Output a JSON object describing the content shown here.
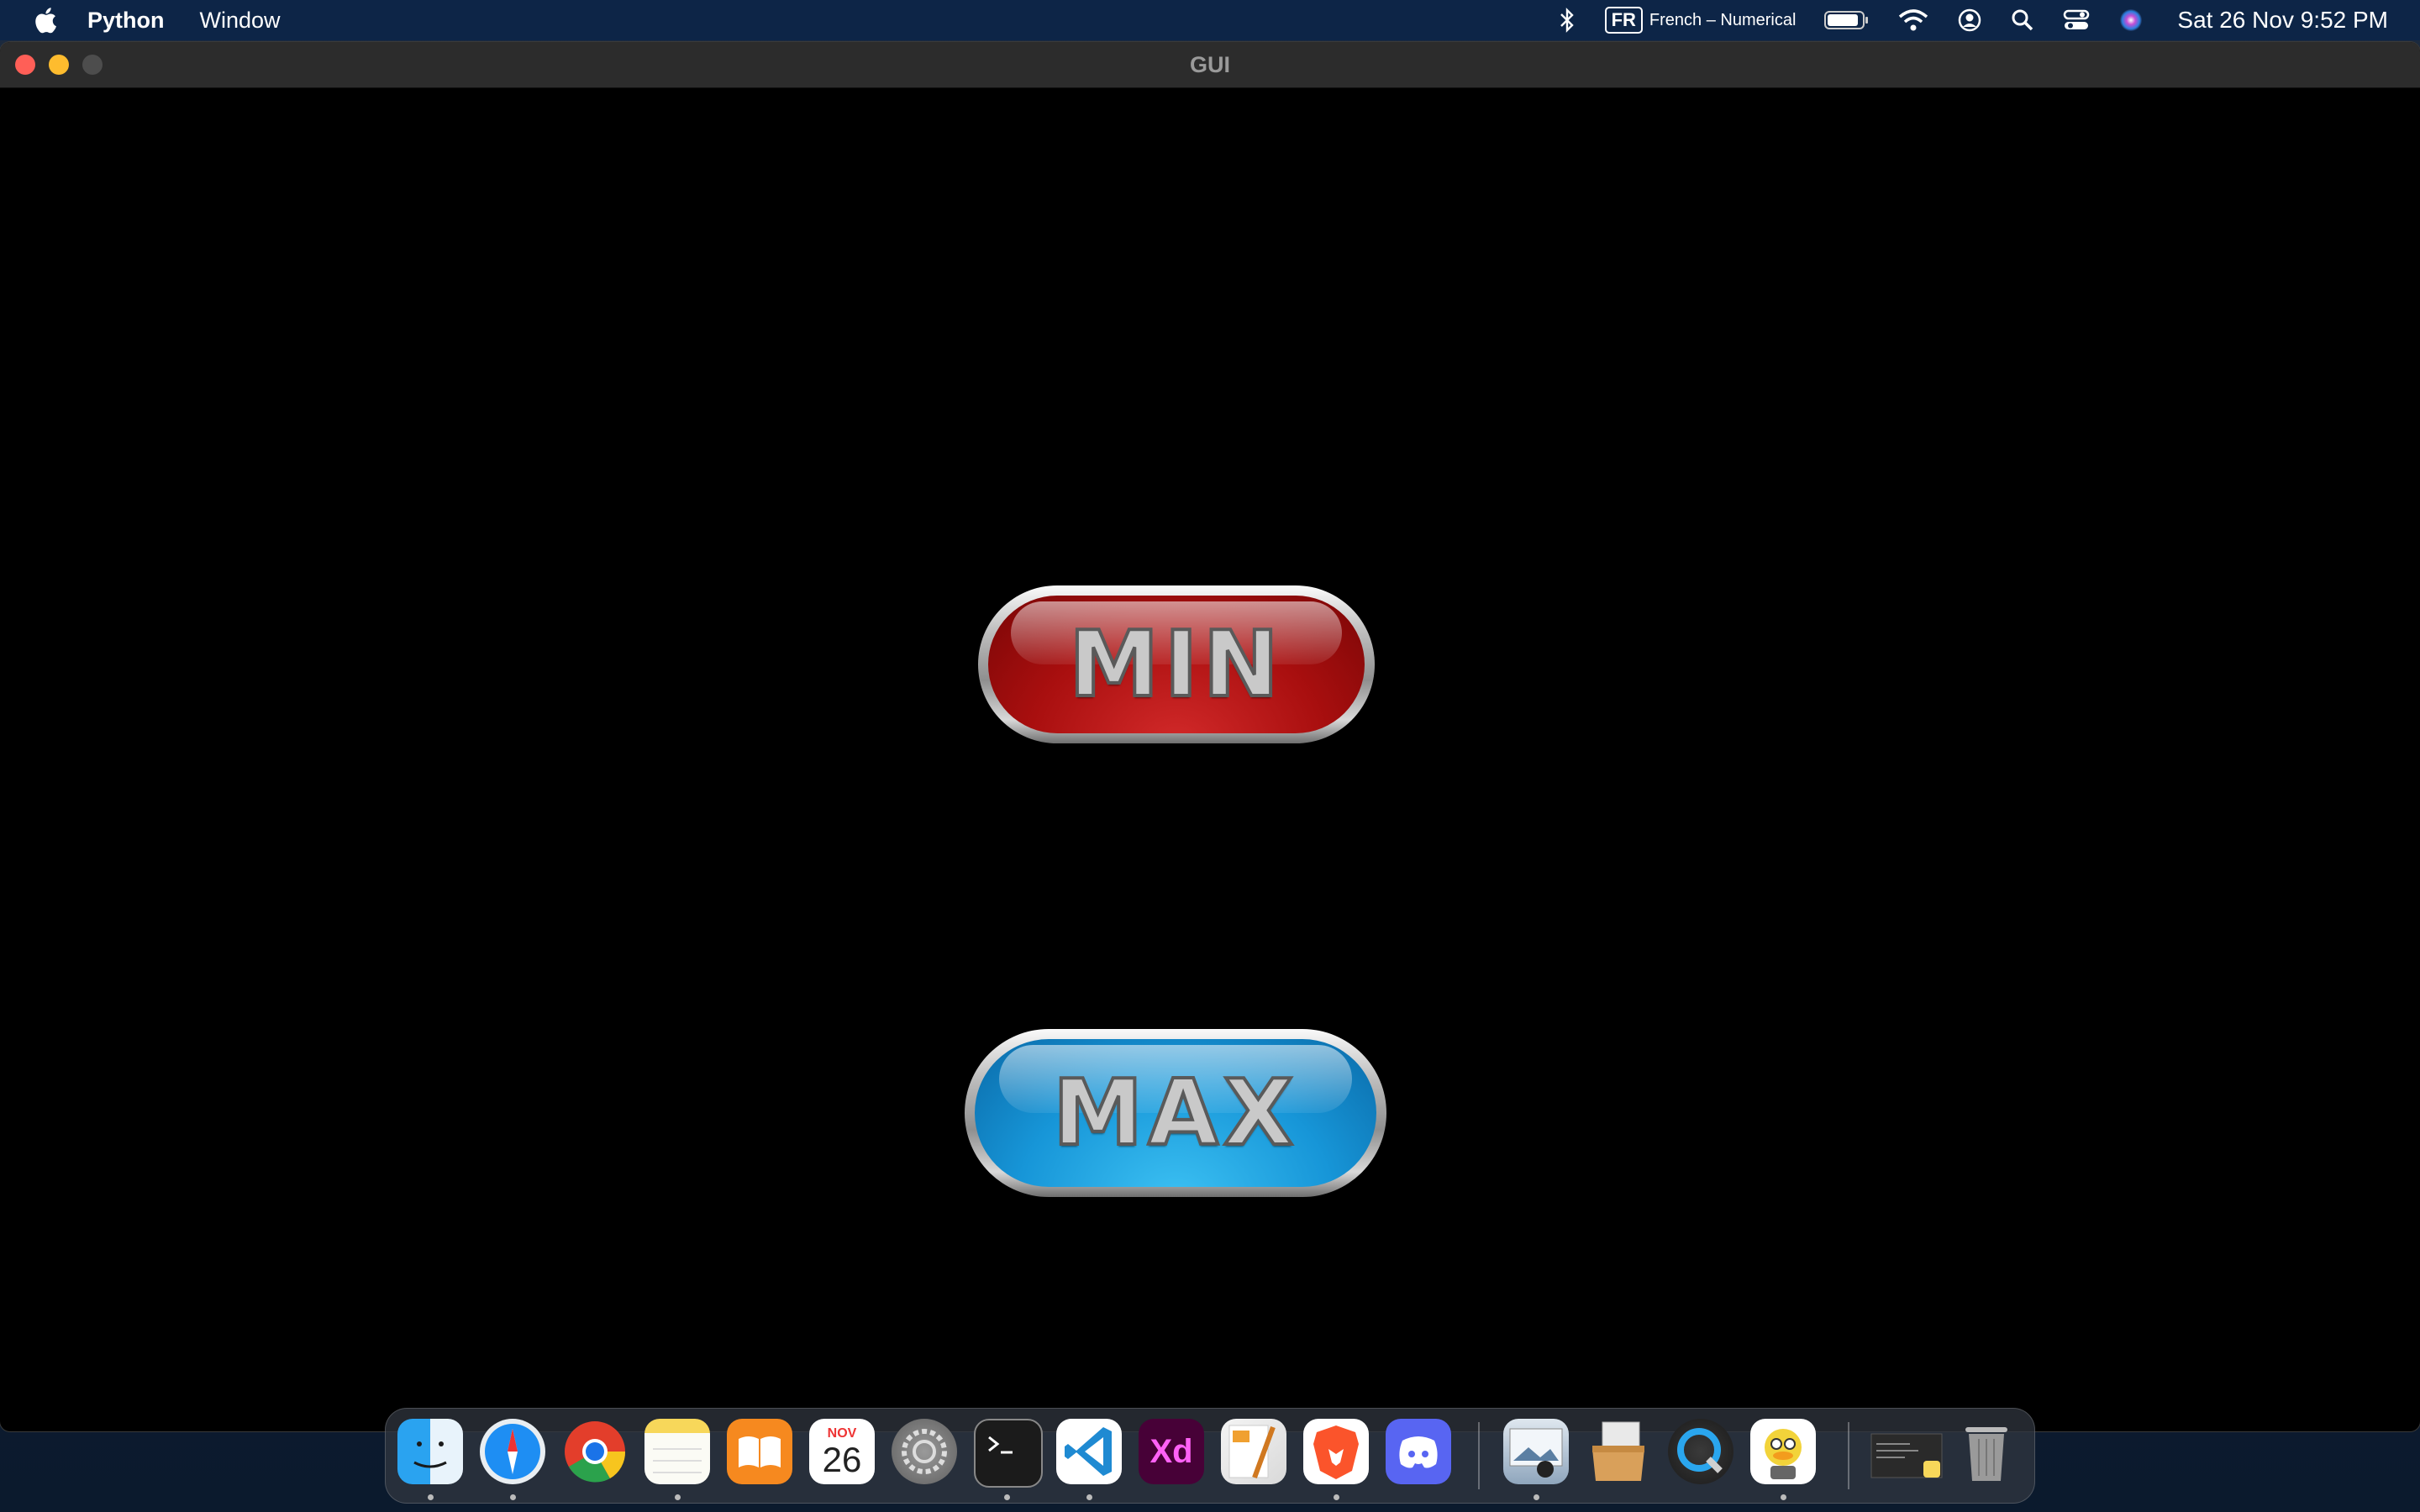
{
  "menubar": {
    "app_name": "Python",
    "menus": [
      "Window"
    ],
    "input_source_code": "FR",
    "input_source_name": "French – Numerical",
    "clock": "Sat 26 Nov  9:52 PM",
    "icons": [
      "apple-icon",
      "bluetooth-icon",
      "input-source-icon",
      "battery-icon",
      "wifi-icon",
      "user-icon",
      "spotlight-icon",
      "control-center-icon",
      "siri-icon"
    ]
  },
  "window": {
    "title": "GUI",
    "buttons": {
      "min_label": "MIN",
      "max_label": "MAX"
    }
  },
  "dock": {
    "calendar_month": "NOV",
    "calendar_day": "26",
    "xd_label": "Xd",
    "apps": [
      "Finder",
      "Safari",
      "Google Chrome",
      "Notes",
      "Books",
      "Calendar",
      "System Preferences",
      "Terminal",
      "Visual Studio Code",
      "Adobe XD",
      "Pages",
      "Brave Browser",
      "Discord",
      "Preview",
      "Archive Utility",
      "QuickTime Player",
      "Cyberduck",
      "Screenshot",
      "Trash"
    ]
  },
  "colors": {
    "menubar_bg": "#0d2547",
    "min_button": "#b01414",
    "max_button": "#1796d8",
    "window_bg": "#000000"
  }
}
